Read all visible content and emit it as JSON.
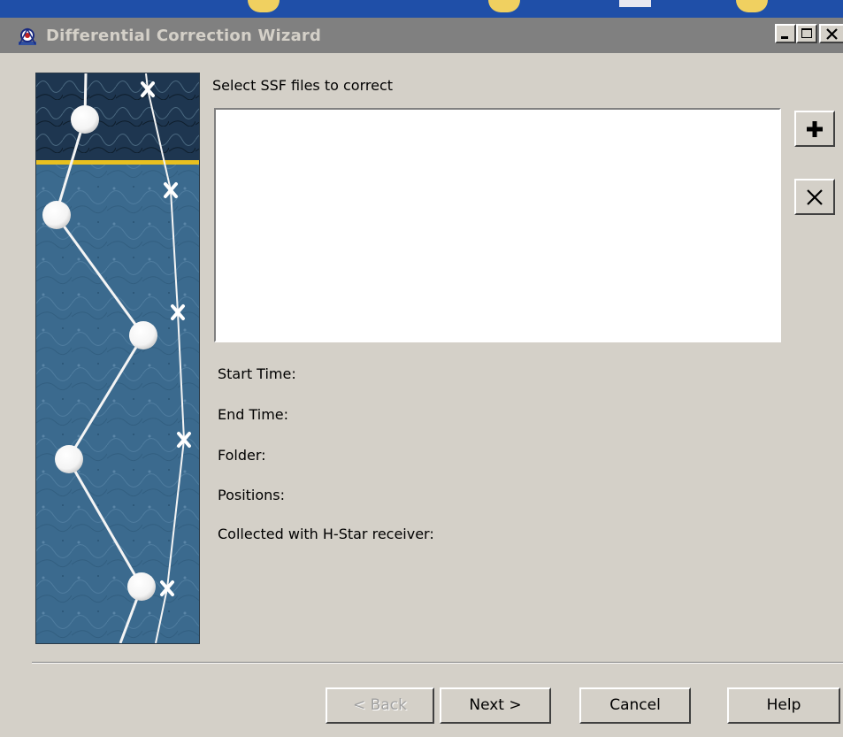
{
  "window": {
    "title": "Differential Correction Wizard",
    "title_bar_color": "#808080"
  },
  "caption_buttons": {
    "minimize_icon": "minimize-icon",
    "maximize_icon": "maximize-icon",
    "close_icon": "close-icon"
  },
  "main": {
    "prompt": "Select SSF files to correct",
    "file_list_items": [],
    "add_icon": "plus-icon",
    "remove_icon": "x-icon"
  },
  "info": {
    "start_time_label": "Start Time:",
    "end_time_label": "End Time:",
    "folder_label": "Folder:",
    "positions_label": "Positions:",
    "hstar_label": "Collected with H-Star receiver:"
  },
  "buttons": {
    "back": "< Back",
    "next": "Next >",
    "cancel": "Cancel",
    "help": "Help"
  },
  "colors": {
    "dialog_background": "#d4d0c8",
    "side_panel_blue": "#3b6a8e",
    "side_panel_divider": "#e8c020"
  }
}
